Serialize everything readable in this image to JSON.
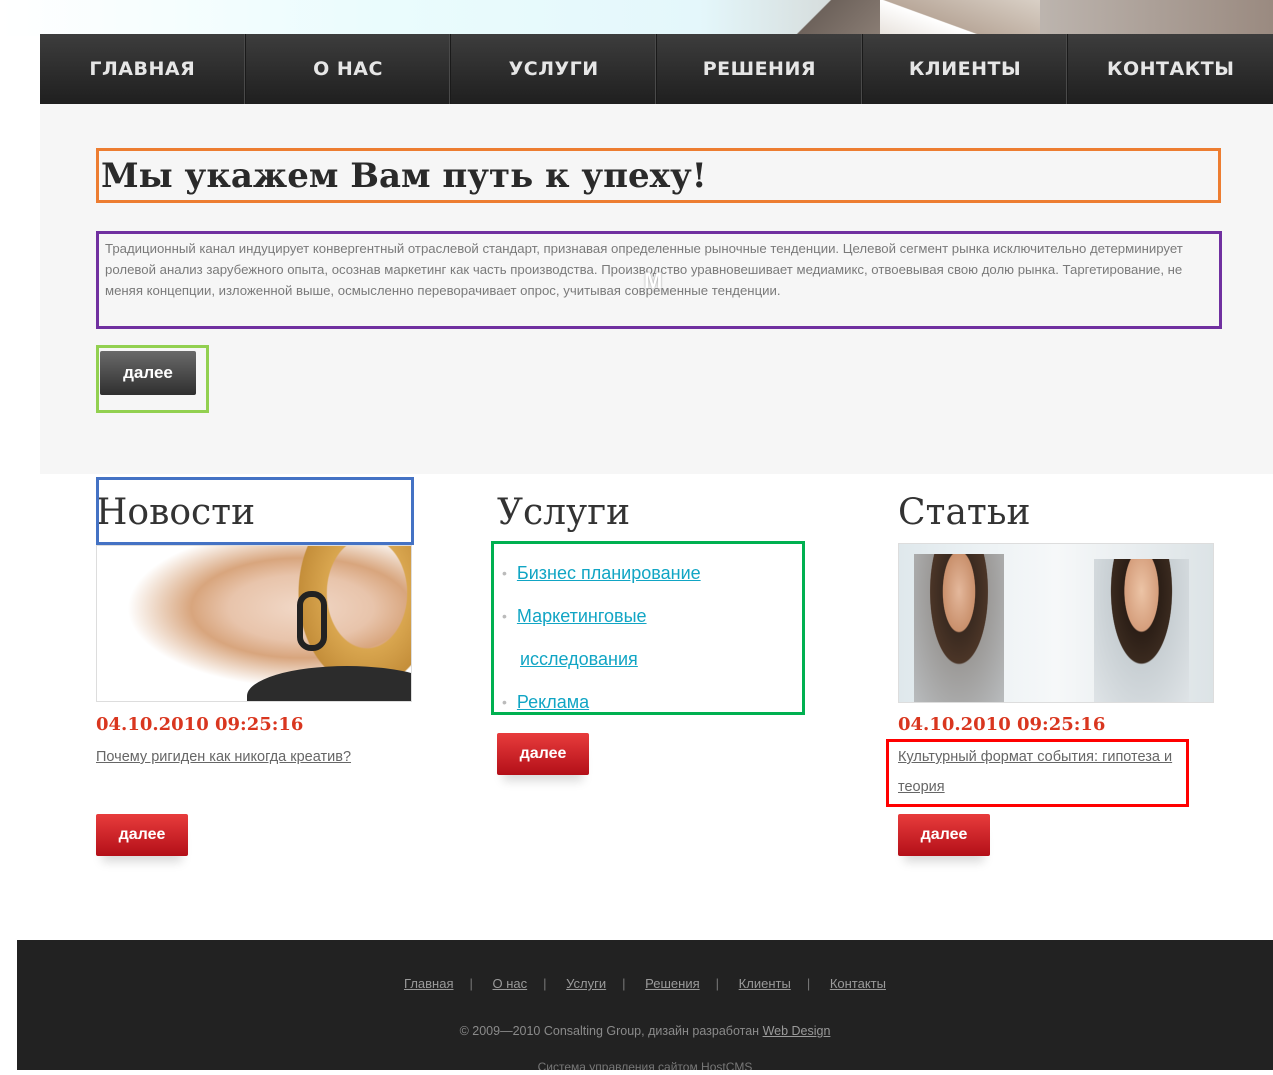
{
  "nav": {
    "items": [
      "ГЛАВНАЯ",
      "О НАС",
      "УСЛУГИ",
      "РЕШЕНИЯ",
      "КЛИЕНТЫ",
      "КОНТАКТЫ"
    ]
  },
  "hero": {
    "headline": "Мы укажем Вам путь к упеху!",
    "text": "Традиционный канал индуцирует конвергентный отраслевой стандарт, признавая определенные рыночные тенденции. Целевой сегмент рынка исключительно детерминирует ролевой анализ зарубежного опыта, осознав маркетинг как часть производства. Производство уравновешивает медиамикс, отвоевывая свою долю рынка. Таргетирование, не меняя концепции, изложенной выше, осмысленно переворачивает опрос, учитывая современные тенденции.",
    "marker": "M",
    "more_label": "далее"
  },
  "news": {
    "title": "Новости",
    "date": "04.10.2010 09:25:16",
    "link": "Почему ригиден как никогда креатив?",
    "more_label": "далее"
  },
  "services": {
    "title": "Услуги",
    "items": [
      {
        "label": "Бизнес планирование"
      },
      {
        "label": "Маркетинговые",
        "cont": "исследования"
      },
      {
        "label": "Реклама"
      }
    ],
    "more_label": "далее"
  },
  "articles": {
    "title": "Статьи",
    "date": "04.10.2010 09:25:16",
    "link": "Культурный формат события: гипотеза и теория",
    "more_label": "далее"
  },
  "footer": {
    "links": [
      "Главная",
      "О нас",
      "Услуги",
      "Решения",
      "Клиенты",
      "Контакты"
    ],
    "copyright_prefix": "© 2009—2010 Consalting Group, дизайн разработан",
    "copyright_link": "Web Design",
    "cms": "Система управления сайтом HostCMS"
  },
  "colors": {
    "accent_red": "#d9361f",
    "link_blue": "#11a5c4",
    "nav_bg": "#2a2a2a",
    "footer_bg": "#222222"
  }
}
